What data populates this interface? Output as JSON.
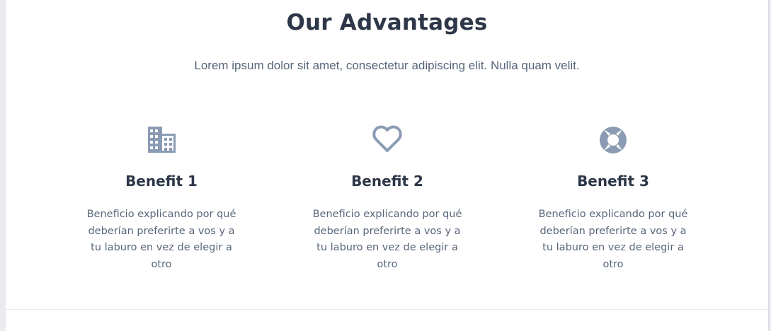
{
  "section": {
    "title": "Our Advantages",
    "subtitle": "Lorem ipsum dolor sit amet, consectetur adipiscing elit. Nulla quam velit."
  },
  "icon_color": "#8a9bb3",
  "benefits": [
    {
      "icon": "building-icon",
      "title": "Benefit 1",
      "description": "Beneficio explicando por qué deberían preferirte a vos y a tu laburo en vez de elegir a otro"
    },
    {
      "icon": "heart-icon",
      "title": "Benefit 2",
      "description": "Beneficio explicando por qué deberían preferirte a vos y a tu laburo en vez de elegir a otro"
    },
    {
      "icon": "lifebuoy-icon",
      "title": "Benefit 3",
      "description": "Beneficio explicando por qué deberían preferirte a vos y a tu laburo en vez de elegir a otro"
    }
  ]
}
